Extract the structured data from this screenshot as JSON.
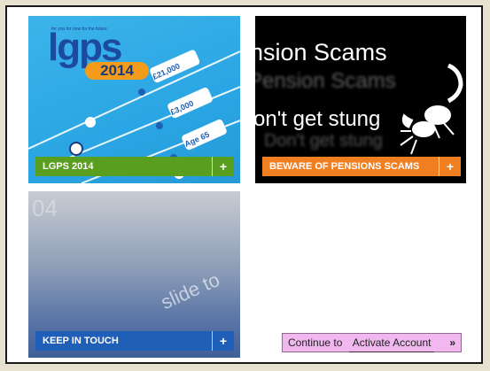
{
  "tiles": {
    "lgps": {
      "tagline": "for you for now for the future",
      "logo_word": "lgps",
      "logo_year": "2014",
      "slider_labels": [
        "£21,000",
        "£3,000",
        "Age 65"
      ],
      "bar_label": "LGPS 2014",
      "plus": "+"
    },
    "scams": {
      "line1": "nsion Scams",
      "line1_reflection": "Pension Scams",
      "line2": "on't get stung",
      "line2_reflection": "Don't get stung",
      "bar_label": "BEWARE OF PENSIONS SCAMS",
      "plus": "+"
    },
    "touch": {
      "time_text": "04",
      "slide_text": "slide to",
      "bar_label": "KEEP IN TOUCH",
      "plus": "+"
    }
  },
  "continue": {
    "prefix": "Continue to",
    "link": "Activate Account",
    "arrow": "»"
  },
  "colors": {
    "green": "#5a9e1f",
    "orange": "#f07f22",
    "blue": "#1f5fb8",
    "continue_bg": "#f0b8ee"
  }
}
